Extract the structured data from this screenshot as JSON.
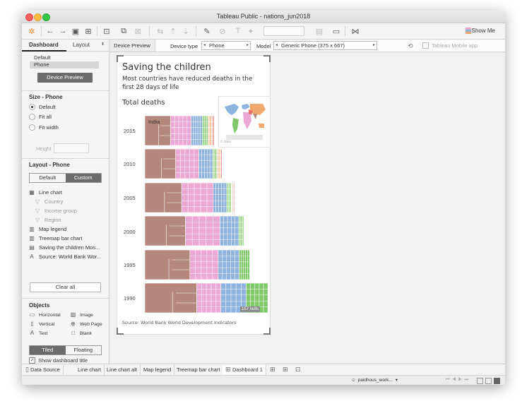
{
  "window": {
    "title": "Tableau Public - nations_jun2018"
  },
  "toolbar": {
    "show_me": "Show Me"
  },
  "sidebar": {
    "tabs": [
      "Dashboard",
      "Layout"
    ],
    "devices": [
      "Default",
      "Phone"
    ],
    "device_preview_button": "Device Preview",
    "size_heading": "Size - Phone",
    "size_options": [
      "Default",
      "Fit all",
      "Fit width"
    ],
    "height_label": "Height",
    "layout_heading": "Layout - Phone",
    "layout_modes": [
      "Default",
      "Custom"
    ],
    "layout_items": [
      {
        "label": "Line chart",
        "icon": "sheet-icon"
      },
      {
        "label": "Country",
        "icon": "filter-icon"
      },
      {
        "label": "Income group",
        "icon": "filter-icon"
      },
      {
        "label": "Region",
        "icon": "filter-icon"
      },
      {
        "label": "Map legend",
        "icon": "legend-icon"
      },
      {
        "label": "Treemap bar chart",
        "icon": "legend-icon"
      },
      {
        "label": "Saving the children Mos...",
        "icon": "title-icon"
      },
      {
        "label": "Source: World Bank Wor...",
        "icon": "text-icon"
      }
    ],
    "clear_all": "Clear all",
    "objects_heading": "Objects",
    "objects": [
      "Horizontal",
      "Image",
      "Vertical",
      "Web Page",
      "Text",
      "Blank"
    ],
    "tiled_floating": [
      "Tiled",
      "Floating"
    ],
    "show_title": "Show dashboard title"
  },
  "devbar": {
    "tab": "Device Preview",
    "device_type_label": "Device type",
    "device_type": "Phone",
    "model_label": "Model",
    "model": "Generic Phone (375 x 667)",
    "mobile_app": "Tableau Mobile app"
  },
  "viz": {
    "title": "Saving the children",
    "subtitle": "Most countries have reduced deaths in the first 28 days of life",
    "total_label": "Total deaths",
    "years": [
      "2015",
      "2010",
      "2005",
      "2000",
      "1995",
      "1990"
    ],
    "highlight_label": "India",
    "osm": "© OSM",
    "nulls_badge": "157 nulls",
    "source": "Source: World Bank World Development Indicators",
    "colors": {
      "brown": "#b6877c",
      "pink": "#eba8d5",
      "blue": "#8db3de",
      "green": "#7fc86a",
      "orange": "#f2a86d",
      "red": "#e7706e",
      "gray": "#c9c9c9"
    },
    "bar_widths": [
      0.7,
      0.78,
      0.91,
      1.0,
      1.06,
      1.22
    ]
  },
  "bottom_tabs": [
    "Data Source",
    "Line chart",
    "Line chart alt",
    "Map legend",
    "Treemap bar chart",
    "Dashboard 1"
  ],
  "status": {
    "user": "paldhous_work..."
  }
}
